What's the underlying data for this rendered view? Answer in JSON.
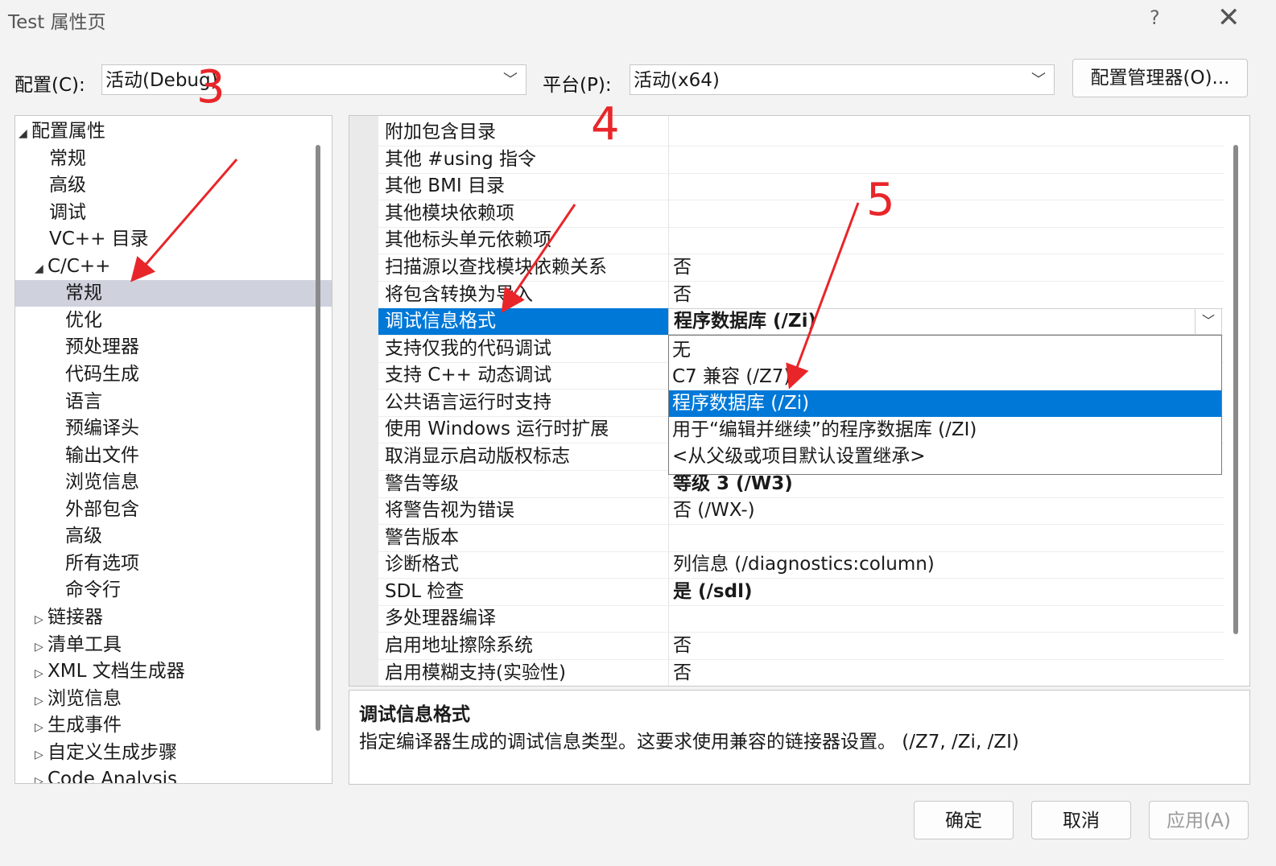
{
  "window": {
    "title": "Test 属性页",
    "help": "?",
    "close": "✕"
  },
  "config": {
    "config_label": "配置(C):",
    "config_value": "活动(Debug)",
    "platform_label": "平台(P):",
    "platform_value": "活动(x64)",
    "manager_button": "配置管理器(O)..."
  },
  "tree": {
    "items": [
      {
        "label": "配置属性",
        "twisty": "◢"
      },
      {
        "label": "常规"
      },
      {
        "label": "高级"
      },
      {
        "label": "调试"
      },
      {
        "label": "VC++ 目录"
      },
      {
        "label": "C/C++",
        "twisty": "◢"
      },
      {
        "label": "常规",
        "selected": true
      },
      {
        "label": "优化"
      },
      {
        "label": "预处理器"
      },
      {
        "label": "代码生成"
      },
      {
        "label": "语言"
      },
      {
        "label": "预编译头"
      },
      {
        "label": "输出文件"
      },
      {
        "label": "浏览信息"
      },
      {
        "label": "外部包含"
      },
      {
        "label": "高级"
      },
      {
        "label": "所有选项"
      },
      {
        "label": "命令行"
      },
      {
        "label": "链接器",
        "twisty": "▷"
      },
      {
        "label": "清单工具",
        "twisty": "▷"
      },
      {
        "label": "XML 文档生成器",
        "twisty": "▷"
      },
      {
        "label": "浏览信息",
        "twisty": "▷"
      },
      {
        "label": "生成事件",
        "twisty": "▷"
      },
      {
        "label": "自定义生成步骤",
        "twisty": "▷"
      },
      {
        "label": "Code Analysis",
        "twisty": "▷"
      }
    ]
  },
  "grid": {
    "rows": [
      {
        "name": "附加包含目录",
        "value": ""
      },
      {
        "name": "其他 #using 指令",
        "value": ""
      },
      {
        "name": "其他 BMI 目录",
        "value": ""
      },
      {
        "name": "其他模块依赖项",
        "value": ""
      },
      {
        "name": "其他标头单元依赖项",
        "value": ""
      },
      {
        "name": "扫描源以查找模块依赖关系",
        "value": "否"
      },
      {
        "name": "将包含转换为导入",
        "value": "否"
      },
      {
        "name": "调试信息格式",
        "value": "程序数据库 (/Zi)",
        "selected": true
      },
      {
        "name": "支持仅我的代码调试",
        "value": ""
      },
      {
        "name": "支持 C++ 动态调试",
        "value": ""
      },
      {
        "name": "公共语言运行时支持",
        "value": ""
      },
      {
        "name": "使用 Windows 运行时扩展",
        "value": ""
      },
      {
        "name": "取消显示启动版权标志",
        "value": ""
      },
      {
        "name": "警告等级",
        "value": "等级 3 (/W3)",
        "bold": true
      },
      {
        "name": "将警告视为错误",
        "value": "否 (/WX-)"
      },
      {
        "name": "警告版本",
        "value": ""
      },
      {
        "name": "诊断格式",
        "value": "列信息 (/diagnostics:column)"
      },
      {
        "name": "SDL 检查",
        "value": "是 (/sdl)",
        "bold": true
      },
      {
        "name": "多处理器编译",
        "value": ""
      },
      {
        "name": "启用地址擦除系统",
        "value": "否"
      },
      {
        "name": "启用模糊支持(实验性)",
        "value": "否"
      }
    ]
  },
  "dropdown": {
    "current": "程序数据库 (/Zi)",
    "options": [
      {
        "label": "无"
      },
      {
        "label": "C7 兼容 (/Z7)"
      },
      {
        "label": "程序数据库 (/Zi)",
        "selected": true
      },
      {
        "label": "用于“编辑并继续”的程序数据库 (/ZI)"
      },
      {
        "label": "<从父级或项目默认设置继承>"
      }
    ]
  },
  "description": {
    "title": "调试信息格式",
    "text": "指定编译器生成的调试信息类型。这要求使用兼容的链接器设置。   (/Z7, /Zi, /ZI)"
  },
  "buttons": {
    "ok": "确定",
    "cancel": "取消",
    "apply": "应用(A)"
  },
  "annotations": {
    "n3": "3",
    "n4": "4",
    "n5": "5"
  },
  "colors": {
    "accent": "#0078d7",
    "annotation": "#e8262a",
    "tree_selected": "#cfd2dd"
  }
}
